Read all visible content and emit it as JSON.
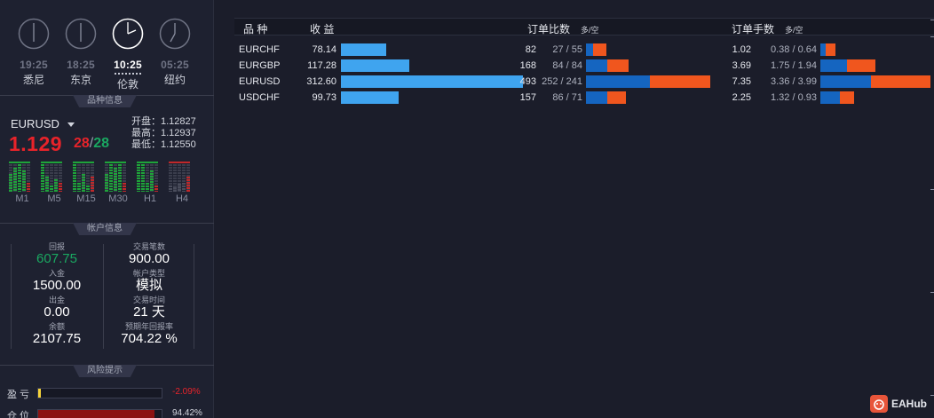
{
  "clocks": [
    {
      "time": "19:25",
      "city": "悉尼",
      "active": false
    },
    {
      "time": "18:25",
      "city": "东京",
      "active": false
    },
    {
      "time": "10:25",
      "city": "伦敦",
      "active": true
    },
    {
      "time": "05:25",
      "city": "纽约",
      "active": false
    }
  ],
  "sections": {
    "symbol_info": "品种信息",
    "account_info": "帐户信息",
    "risk": "风险提示"
  },
  "symbol": {
    "name": "EURUSD",
    "price_big": "1.129",
    "price_frac_a": "28",
    "price_frac_sep": "/",
    "price_frac_b": "28",
    "open": "开盘：1.12827",
    "high": "最高：1.12937",
    "low": "最低：1.12550"
  },
  "timeframes": [
    "M1",
    "M5",
    "M15",
    "M30",
    "H1",
    "H4"
  ],
  "account": {
    "items": [
      {
        "label": "回报",
        "value": "607.75",
        "color": "green"
      },
      {
        "label": "交易笔数",
        "value": "900.00"
      },
      {
        "label": "入金",
        "value": "1500.00"
      },
      {
        "label": "帐户类型",
        "value": "模拟"
      },
      {
        "label": "出金",
        "value": "0.00"
      },
      {
        "label": "交易时间",
        "value": "21 天"
      },
      {
        "label": "余额",
        "value": "2107.75"
      },
      {
        "label": "预期年回报率",
        "value": "704.22 %"
      }
    ]
  },
  "risk": [
    {
      "label": "盈 亏",
      "pct": "-2.09%",
      "level": 0.02,
      "pct_color": "#e8232a",
      "fill": "#f5d33a"
    },
    {
      "label": "仓 位",
      "pct": "94.42%",
      "level": 0.9442,
      "pct_color": "#d4d7df",
      "fill": "#8b1212"
    }
  ],
  "table": {
    "headers": {
      "symbol": "品 种",
      "profit": "收 益",
      "order_ratio": "订单比数",
      "order_ratio_sub": "多/空",
      "lot_ratio": "订单手数",
      "lot_ratio_sub": "多/空"
    },
    "rows": [
      {
        "symbol": "EURCHF",
        "profit": "78.14",
        "orders": "82",
        "orders_ratio": "27 / 55",
        "lots": "1.02",
        "lots_ratio": "0.38 / 0.64"
      },
      {
        "symbol": "EURGBP",
        "profit": "117.28",
        "orders": "168",
        "orders_ratio": "84 / 84",
        "lots": "3.69",
        "lots_ratio": "1.75 / 1.94"
      },
      {
        "symbol": "EURUSD",
        "profit": "312.60",
        "orders": "493",
        "orders_ratio": "252 / 241",
        "lots": "7.35",
        "lots_ratio": "3.36 / 3.99"
      },
      {
        "symbol": "USDCHF",
        "profit": "99.73",
        "orders": "157",
        "orders_ratio": "86 / 71",
        "lots": "2.25",
        "lots_ratio": "1.32 / 0.93"
      }
    ]
  },
  "colors": {
    "long": "#1565c0",
    "short": "#f0561e",
    "profit_bar": "#3fa4ef"
  },
  "logo": "EAHub"
}
